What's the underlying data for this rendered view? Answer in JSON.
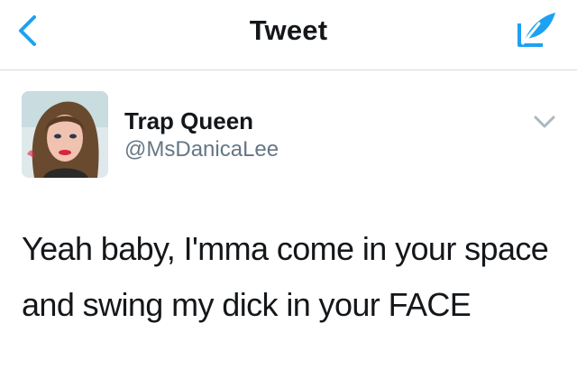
{
  "navbar": {
    "title": "Tweet",
    "back_icon": "chevron-left-icon",
    "compose_icon": "compose-feather-icon",
    "accent_color": "#1da1f2"
  },
  "tweet": {
    "author": {
      "name": "Trap Queen",
      "handle": "@MsDanicaLee"
    },
    "text": "Yeah baby, I'mma come in your space and swing my dick in your FACE",
    "menu_icon": "chevron-down-icon"
  },
  "colors": {
    "text_primary": "#14171a",
    "text_secondary": "#657786",
    "divider": "#d8dde2",
    "caret": "#aab8c2"
  }
}
